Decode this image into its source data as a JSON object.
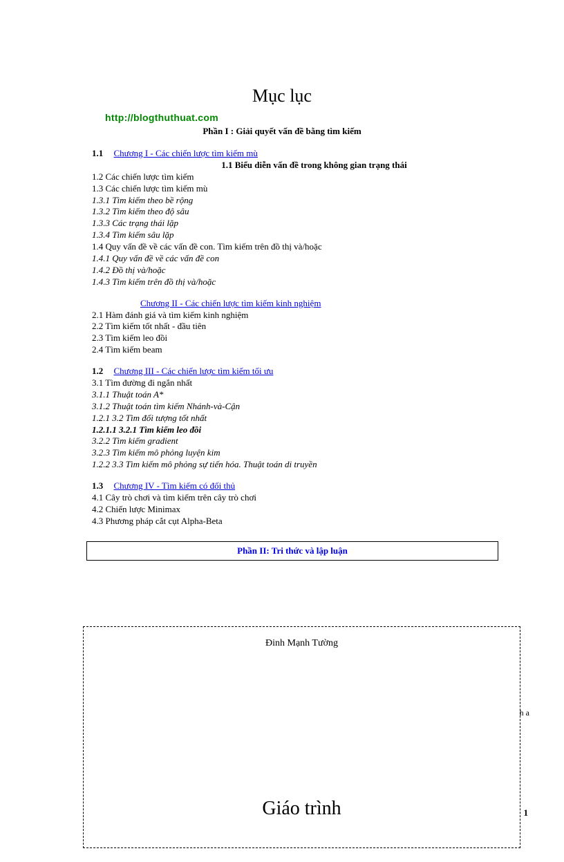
{
  "header": {
    "url": "http://blogthuthuat.com"
  },
  "title": "Mục lục",
  "part1_title": "Phần I : Giải quyết vấn đề bằng tìm kiếm",
  "ch1": {
    "num": "1.1",
    "link": "Chương   I  - Các chiến lược   tìm kiếm mù",
    "subtitle": "1.1 Biểu diễn vấn đề trong không gian trạng thái",
    "e1": "1.2 Các chiến lược   tìm kiếm",
    "e2": "1.3 Các chiến lược   tìm kiếm mù",
    "e3": "1.3.1 Tìm kiếm theo bề rộng",
    "e4": "1.3.2 Tìm kiếm theo độ sâu",
    "e5": "1.3.3 Các trạng thái lặp",
    "e6": "1.3.4 Tìm kiếm sâu lặp",
    "e7": "1.4 Quy vấn đề về các vấn đề con. Tìm kiếm trên đồ thị và/hoặc",
    "e8": "1.4.1 Quy vấn đề về các vấn đề con",
    "e9": "1.4.2 Đồ thị và/hoặc",
    "e10": "1.4.3 Tìm kiếm trên đồ thị và/hoặc"
  },
  "ch2": {
    "link": "Chương   II - Các chiến lược   tìm kiếm kinh nghiệm",
    "e1": "2.1 Hàm đánh giá và tìm kiếm kinh nghiệm",
    "e2": "2.2 Tìm kiếm tốt nhất - đầu tiên",
    "e3": "2.3 Tìm kiếm leo đồi",
    "e4": "2.4 Tìm kiếm beam"
  },
  "ch3": {
    "num": "1.2",
    "link": "Chương   III - Các chiến lược   tìm kiếm tối ưu",
    "e1": "3.1 Tìm đường   đi ngắn nhất",
    "e2": "3.1.1 Thuật toán A*",
    "e3": "3.1.2 Thuật toán tìm kiếm Nhánh-và-Cận",
    "e4": "1.2.1   3.2 Tìm đối tượng   tốt nhất",
    "e5": "1.2.1.1   3.2.1 Tìm kiếm leo đồi",
    "e6": "3.2.2 Tìm kiếm gradient",
    "e7": "3.2.3 Tìm kiếm mô phỏng luyện kim",
    "e8": "1.2.2   3.3 Tìm kiếm mô phỏng sự tiến hóa. Thuật toán di truyền"
  },
  "ch4": {
    "num": "1.3",
    "link": "Chương   IV - Tìm kiếm có đối thủ",
    "e1": "4.1 Cây trò chơi và tìm kiếm trên cây trò chơi",
    "e2": "4.2 Chiến lược   Minimax",
    "e3": "4.3 Phương   pháp cắt cụt Alpha-Beta"
  },
  "part2_title": "Phần II: Tri thức và lập luận",
  "author": "Đinh Mạnh Tường",
  "side_text": "h\na",
  "course_title": "Giáo trình",
  "page_number": "1"
}
